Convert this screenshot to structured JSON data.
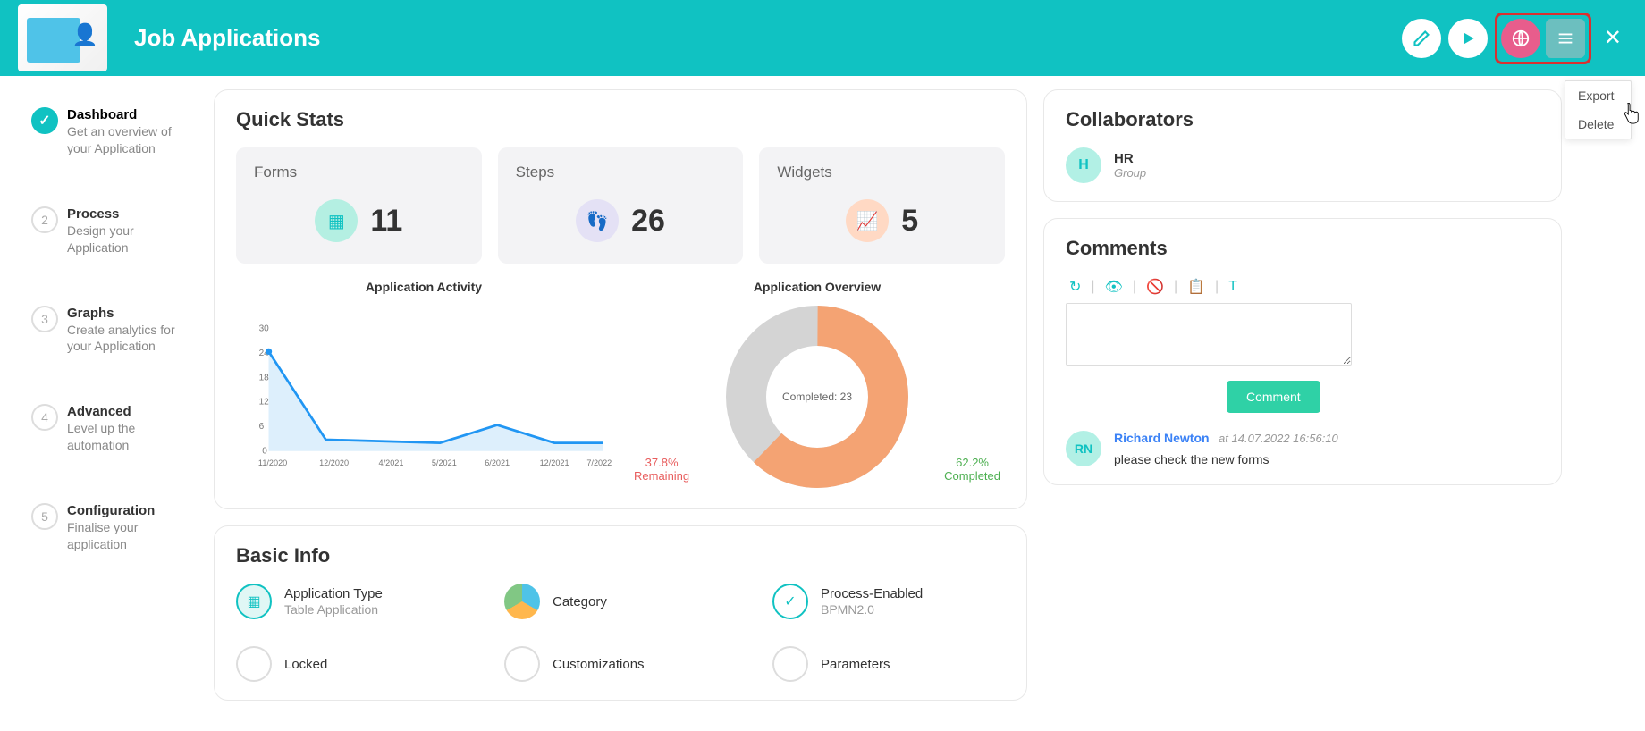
{
  "header": {
    "title": "Job Applications",
    "close": "✕",
    "menu_items": {
      "export": "Export",
      "delete": "Delete"
    }
  },
  "sidebar": {
    "steps": [
      {
        "num": "",
        "title": "Dashboard",
        "desc": "Get an overview of your Application",
        "active": true
      },
      {
        "num": "2",
        "title": "Process",
        "desc": "Design your Application"
      },
      {
        "num": "3",
        "title": "Graphs",
        "desc": "Create analytics for your Application"
      },
      {
        "num": "4",
        "title": "Advanced",
        "desc": "Level up the automation"
      },
      {
        "num": "5",
        "title": "Configuration",
        "desc": "Finalise your application"
      }
    ]
  },
  "quick_stats": {
    "title": "Quick Stats",
    "cards": [
      {
        "label": "Forms",
        "value": "11"
      },
      {
        "label": "Steps",
        "value": "26"
      },
      {
        "label": "Widgets",
        "value": "5"
      }
    ]
  },
  "chart_data": [
    {
      "type": "area",
      "title": "Application Activity",
      "categories": [
        "11/2020",
        "12/2020",
        "4/2021",
        "5/2021",
        "6/2021",
        "12/2021",
        "7/2022"
      ],
      "values": [
        25,
        3,
        3,
        2,
        7,
        2,
        2
      ],
      "ylim": [
        0,
        30
      ],
      "yticks": [
        0,
        6,
        12,
        18,
        24,
        30
      ],
      "xlabel": "",
      "ylabel": ""
    },
    {
      "type": "pie",
      "title": "Application Overview",
      "center_label": "Completed: 23",
      "series": [
        {
          "name": "Completed",
          "value": 62.2,
          "color": "#f4a373"
        },
        {
          "name": "Remaining",
          "value": 37.8,
          "color": "#d4d4d4"
        }
      ],
      "labels": {
        "left": {
          "pct": "37.8%",
          "name": "Remaining"
        },
        "right": {
          "pct": "62.2%",
          "name": "Completed"
        }
      }
    }
  ],
  "basic_info": {
    "title": "Basic Info",
    "items": [
      {
        "label": "Application Type",
        "value": "Table Application"
      },
      {
        "label": "Category",
        "value": ""
      },
      {
        "label": "Process-Enabled",
        "value": "BPMN2.0"
      },
      {
        "label": "Locked",
        "value": ""
      },
      {
        "label": "Customizations",
        "value": ""
      },
      {
        "label": "Parameters",
        "value": ""
      }
    ]
  },
  "collaborators": {
    "title": "Collaborators",
    "list": [
      {
        "initial": "H",
        "name": "HR",
        "type": "Group"
      }
    ]
  },
  "comments": {
    "title": "Comments",
    "submit_label": "Comment",
    "entries": [
      {
        "initials": "RN",
        "author": "Richard Newton",
        "at_label": "at",
        "time": "14.07.2022 16:56:10",
        "text": "please check the new forms"
      }
    ]
  }
}
